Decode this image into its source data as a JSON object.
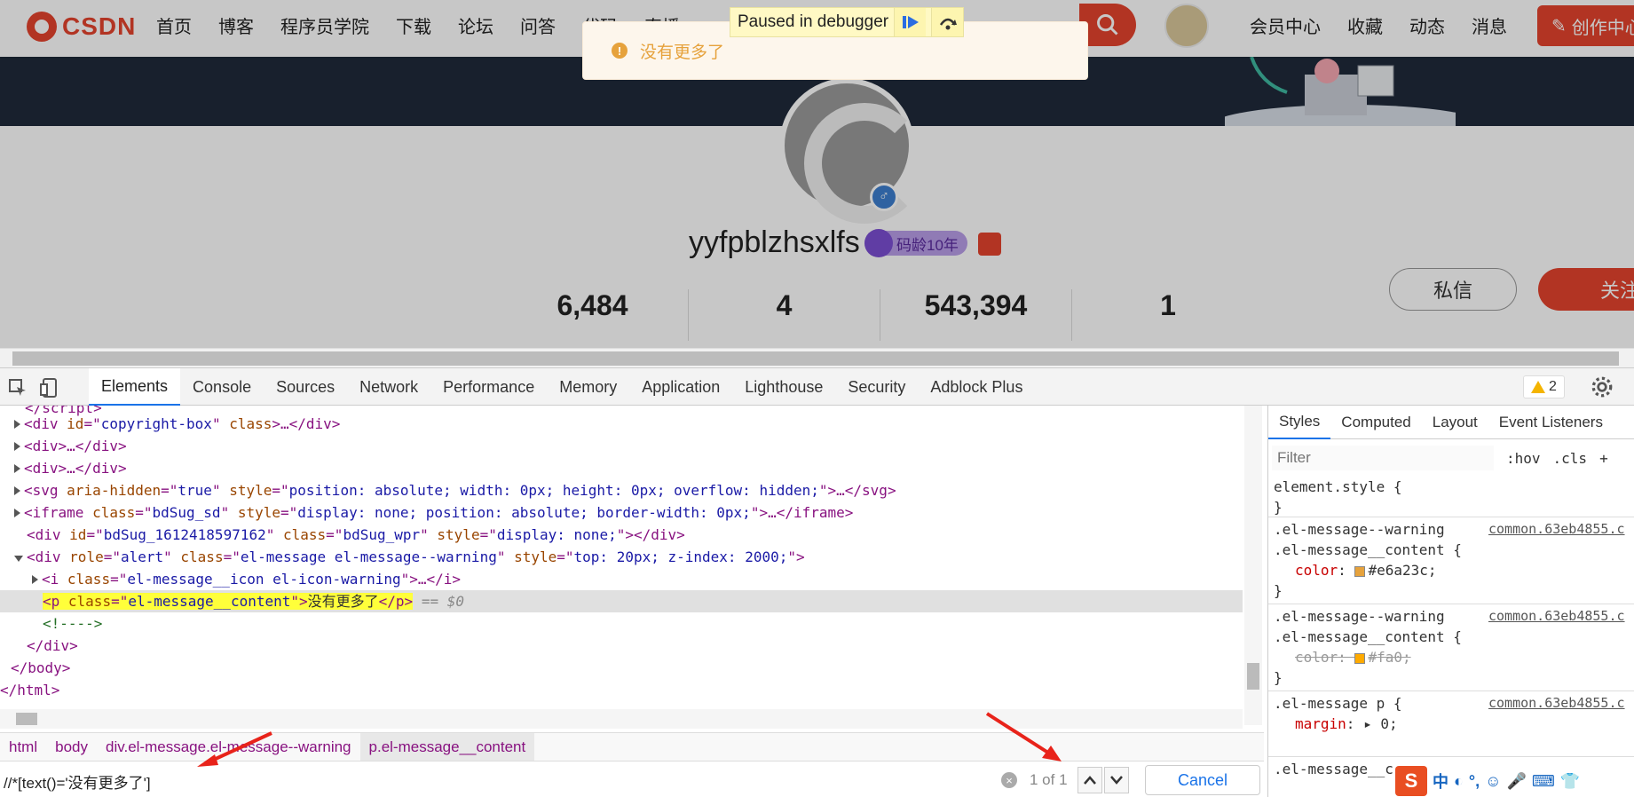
{
  "site": {
    "logo_text": "CSDN",
    "nav": [
      "首页",
      "博客",
      "程序员学院",
      "下载",
      "论坛",
      "问答",
      "代码",
      "直播"
    ],
    "nav_right": [
      "会员中心",
      "收藏",
      "动态",
      "消息"
    ],
    "create_label": "创作中心",
    "username": "yyfpblzhsxlfs",
    "badge": "码龄10年",
    "message_btn": "私信",
    "follow_btn": "关注",
    "stats": [
      "6,484",
      "4",
      "543,394",
      "1"
    ],
    "toast": "没有更多了",
    "debugger": "Paused in debugger"
  },
  "devtools": {
    "tabs": [
      "Elements",
      "Console",
      "Sources",
      "Network",
      "Performance",
      "Memory",
      "Application",
      "Lighthouse",
      "Security",
      "Adblock Plus"
    ],
    "warning_count": "2",
    "breadcrumbs": [
      "html",
      "body",
      "div.el-message.el-message--warning",
      "p.el-message__content"
    ],
    "search_query": "//*[text()='没有更多了']",
    "search_count": "1 of 1",
    "cancel_label": "Cancel",
    "styles_tabs": [
      "Styles",
      "Computed",
      "Layout",
      "Event Listeners"
    ],
    "filter_placeholder": "Filter",
    "filter_hov": ":hov",
    "filter_cls": ".cls",
    "filter_add": "+",
    "dom": {
      "copyright_id": "copyright-box",
      "svg_style": "position: absolute; width: 0px; height: 0px; overflow: hidden;",
      "iframe_class": "bdSug_sd",
      "iframe_style": "display: none; position: absolute; border-width: 0px;",
      "bdsug_id": "bdSug_1612418597162",
      "bdsug_class": "bdSug_wpr",
      "bdsug_style": "display: none;",
      "alert_class": "el-message el-message--warning",
      "alert_style": "top: 20px; z-index: 2000;",
      "icon_class": "el-message__icon el-icon-warning",
      "p_class": "el-message__content",
      "p_text": "没有更多了",
      "eq": "== $0"
    },
    "rules": [
      {
        "selector": "element.style {",
        "source": ""
      },
      {
        "selector": ".el-message--warning\n.el-message__content {",
        "source": "common.63eb4855.c",
        "prop": "color",
        "value": "#e6a23c",
        "swatch": "#e6a23c"
      },
      {
        "selector": ".el-message--warning\n.el-message__content {",
        "source": "common.63eb4855.c",
        "prop": "color",
        "value": "#fa0",
        "swatch": "#ffaa00"
      },
      {
        "selector": ".el-message p {",
        "source": "common.63eb4855.c",
        "prop": "margin",
        "value": "0;"
      },
      {
        "selector": ".el-message__c",
        "source": ""
      }
    ]
  },
  "ime": {
    "s": "S",
    "items": [
      "中",
      "◐",
      "°,",
      "☺",
      "🎤",
      "⌨",
      "👕"
    ]
  }
}
